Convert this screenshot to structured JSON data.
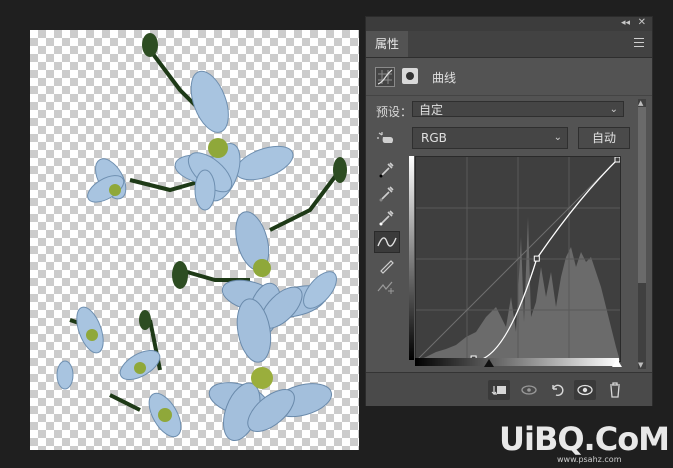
{
  "panel": {
    "tab_label": "属性",
    "adjustment_title": "曲线",
    "preset_label": "预设：",
    "preset_value": "自定",
    "channel_value": "RGB",
    "auto_button": "自动"
  },
  "curve": {
    "input_range": [
      0,
      255
    ],
    "output_range": [
      0,
      255
    ],
    "points": [
      {
        "input": 72,
        "output": 0
      },
      {
        "input": 151,
        "output": 128
      },
      {
        "input": 255,
        "output": 255
      }
    ]
  },
  "icons": {
    "titlebar": [
      "collapse-icon",
      "close-icon"
    ],
    "tools": [
      "on-image-adjust-icon",
      "black-point-eyedropper-icon",
      "gray-point-eyedropper-icon",
      "white-point-eyedropper-icon",
      "curve-edit-icon",
      "pencil-icon",
      "smooth-icon"
    ],
    "bottom": [
      "clip-to-layer-icon",
      "view-previous-icon",
      "reset-icon",
      "visibility-icon",
      "delete-icon"
    ]
  },
  "watermark": {
    "main": "UiBQ.CoM",
    "sub": "www.psahz.com"
  },
  "colors": {
    "panel_bg": "#535353",
    "graph_bg": "#3f3f3f",
    "canvas_checker": "#cccccc"
  }
}
